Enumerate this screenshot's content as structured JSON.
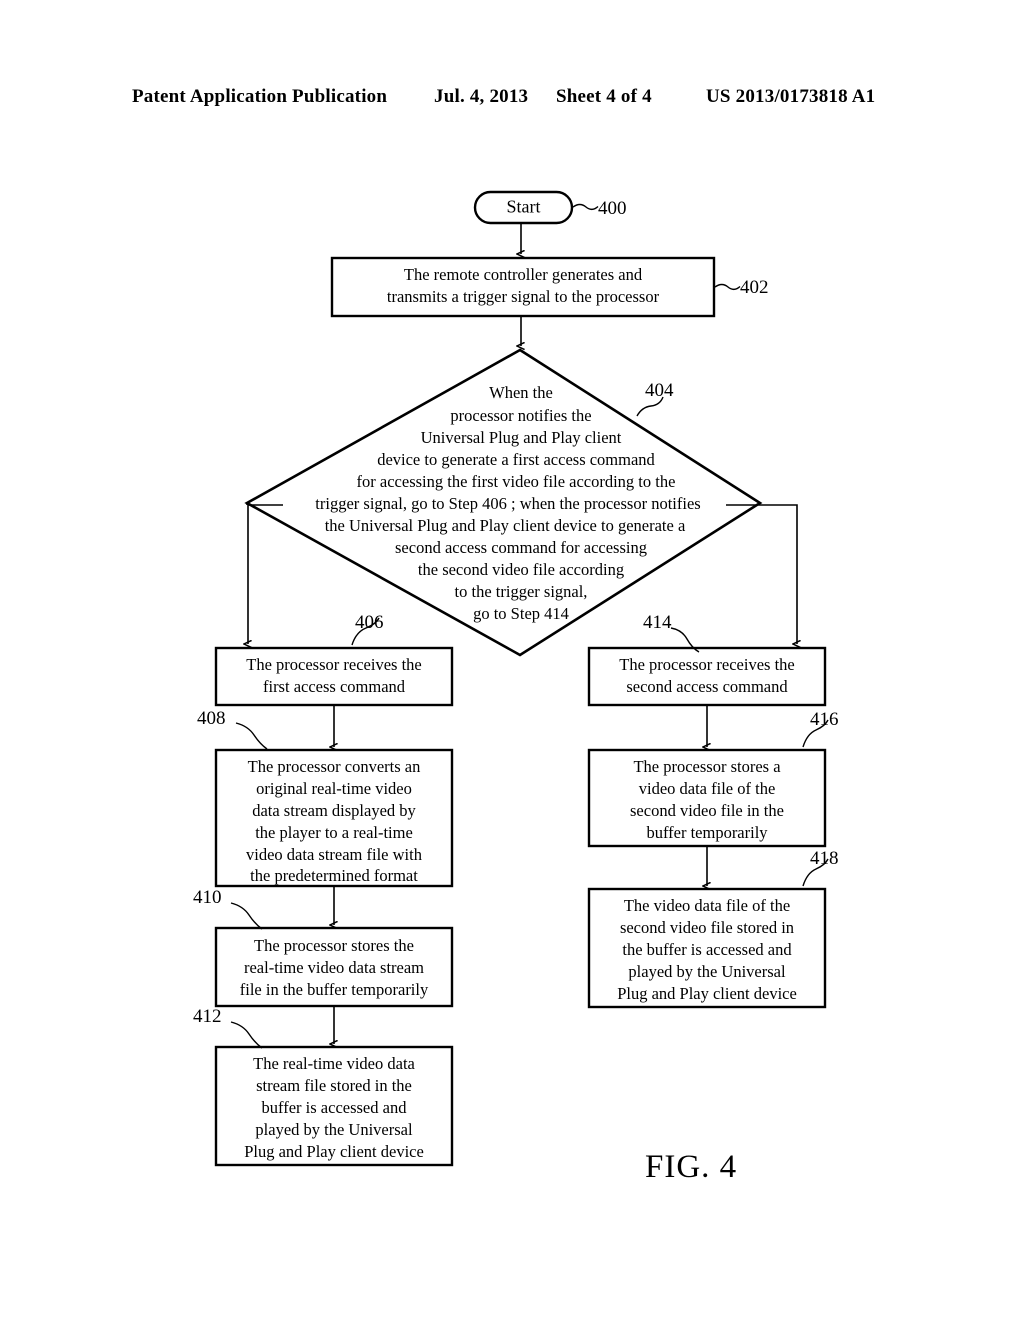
{
  "header": {
    "publication": "Patent Application Publication",
    "date": "Jul. 4, 2013",
    "sheet": "Sheet 4 of 4",
    "pub_number": "US 2013/0173818 A1"
  },
  "figure": {
    "caption": "FIG. 4",
    "start": {
      "ref": "400",
      "label": "Start"
    },
    "nodes": [
      {
        "ref": "402",
        "shape": "rect",
        "lines": [
          "The remote controller generates and",
          "transmits a trigger signal to the processor"
        ]
      },
      {
        "ref": "404",
        "shape": "diamond",
        "lines": [
          "When the",
          "processor notifies the",
          "Universal Plug and Play client",
          "device to generate a first access command",
          "for accessing the first video file according to the",
          "trigger signal, go to Step 406 ; when the processor notifies",
          "the Universal Plug and Play client device to generate a",
          "second access command for accessing",
          "the second video file according",
          "to the trigger signal,",
          "go to Step 414"
        ]
      },
      {
        "ref": "406",
        "shape": "rect",
        "lines": [
          "The processor receives the",
          "first access command"
        ]
      },
      {
        "ref": "408",
        "shape": "rect",
        "lines": [
          "The processor converts an",
          "original real-time video",
          "data stream displayed by",
          "the player to a real-time",
          "video data stream file with",
          "the predetermined format"
        ]
      },
      {
        "ref": "410",
        "shape": "rect",
        "lines": [
          "The processor stores the",
          "real-time video data stream",
          "file in the buffer temporarily"
        ]
      },
      {
        "ref": "412",
        "shape": "rect",
        "lines": [
          "The real-time video data",
          "stream file stored in the",
          "buffer is accessed and",
          "played by the Universal",
          "Plug and Play client device"
        ]
      },
      {
        "ref": "414",
        "shape": "rect",
        "lines": [
          "The processor receives the",
          "second access command"
        ]
      },
      {
        "ref": "416",
        "shape": "rect",
        "lines": [
          "The processor stores a",
          "video data file of the",
          "second video file in the",
          "buffer temporarily"
        ]
      },
      {
        "ref": "418",
        "shape": "rect",
        "lines": [
          "The video data file of the",
          "second video file stored in",
          "the buffer is accessed and",
          "played by the Universal",
          "Plug and Play client device"
        ]
      }
    ]
  },
  "colors": {
    "ink": "#000000",
    "paper": "#ffffff"
  }
}
